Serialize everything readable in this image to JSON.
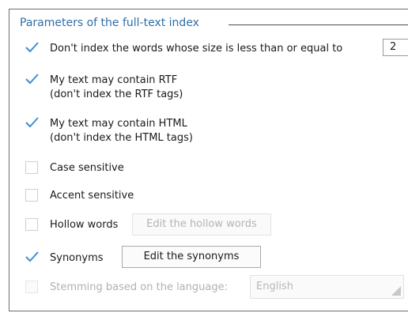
{
  "group": {
    "title": "Parameters of the full-text index"
  },
  "options": {
    "min_word_size": {
      "label": "Don't index the words whose size is less than or equal to",
      "value": "2",
      "checked": true
    },
    "rtf": {
      "label": "My text may contain RTF",
      "sublabel": "(don't index the RTF tags)",
      "checked": true
    },
    "html": {
      "label": "My text may contain HTML",
      "sublabel": "(don't index the HTML tags)",
      "checked": true
    },
    "case_sensitive": {
      "label": "Case sensitive",
      "checked": false
    },
    "accent_sensitive": {
      "label": "Accent sensitive",
      "checked": false
    },
    "hollow_words": {
      "label": "Hollow words",
      "checked": false,
      "button_label": "Edit the hollow words"
    },
    "synonyms": {
      "label": "Synonyms",
      "checked": true,
      "button_label": "Edit the synonyms"
    },
    "stemming": {
      "label": "Stemming based on the language:",
      "checked": false,
      "enabled": false,
      "language": "English"
    }
  },
  "colors": {
    "accent": "#2f6fa6",
    "check": "#3d8fd6",
    "disabled_text": "#b0b0b0"
  }
}
